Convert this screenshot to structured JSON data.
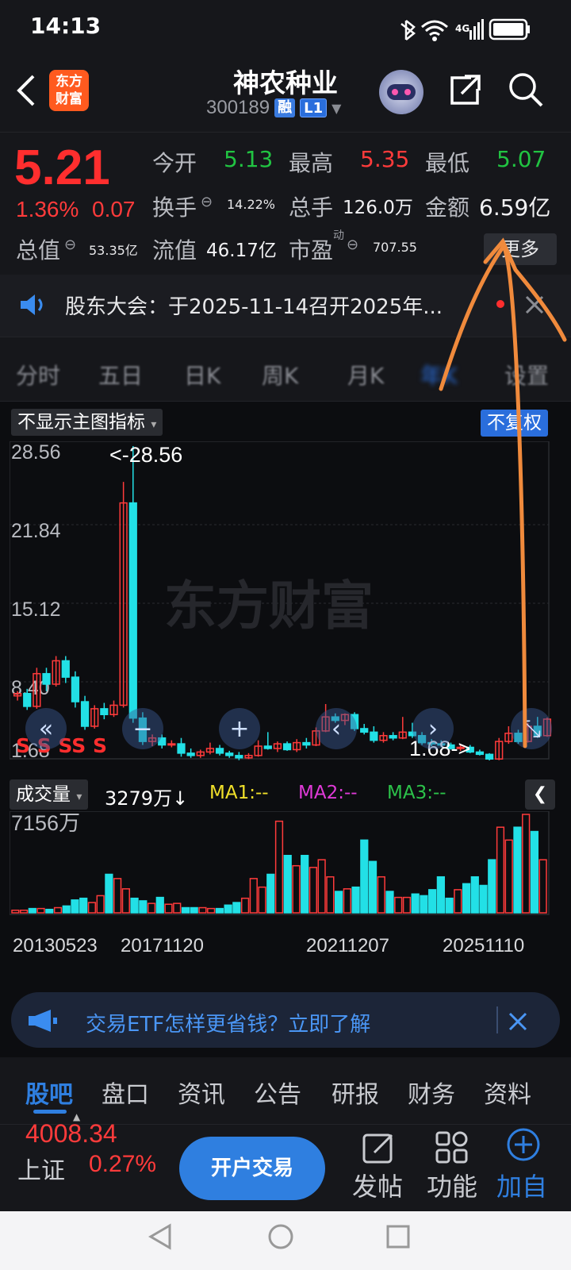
{
  "status_bar": {
    "time": "14:13",
    "network": "4G"
  },
  "header": {
    "back_icon": "chevron-left-icon",
    "logo_text": "东方\n财富",
    "title": "神农种业",
    "code": "300189",
    "tag_margin": "融",
    "tag_level": "L1"
  },
  "quote": {
    "price": "5.21",
    "change_pct": "1.36%",
    "change": "0.07",
    "open_label": "今开",
    "open": "5.13",
    "high_label": "最高",
    "high": "5.35",
    "low_label": "最低",
    "low": "5.07",
    "turnover_label": "换手",
    "turnover": "14.22%",
    "volume_label": "总手",
    "volume": "126.0万",
    "amount_label": "金额",
    "amount": "6.59亿",
    "mktcap_label": "总值",
    "mktcap": "53.35亿",
    "float_label": "流值",
    "float": "46.17亿",
    "pe_label": "市盈",
    "pe_sup": "动",
    "pe": "707.55",
    "more_label": "更多"
  },
  "notice": {
    "text": "股东大会：于2025-11-14召开2025年..."
  },
  "period_tabs": [
    "分时",
    "五日",
    "日K",
    "周K",
    "月K",
    "年K",
    "设置"
  ],
  "chart": {
    "indicator_label": "不显示主图指标",
    "adjust_label": "不复权",
    "y_ticks": [
      "28.56",
      "21.84",
      "15.12",
      "8.40",
      "1.68"
    ],
    "max_marker": "<-28.56",
    "min_marker": "1.68->",
    "watermark": "东方财富",
    "signals": "S   S   SS   S",
    "colors": {
      "up": "#ff3b3b",
      "down": "#22e0e6"
    }
  },
  "volume": {
    "label": "成交量",
    "current": "3279万↓",
    "ma1": "MA1:--",
    "ma2": "MA2:--",
    "ma3": "MA3:--",
    "max_label": "7156万"
  },
  "x_dates": [
    "20130523",
    "20171120",
    "20211207",
    "20251110"
  ],
  "ad": {
    "text": "交易ETF怎样更省钱？立即了解"
  },
  "bottom_tabs": [
    "股吧",
    "盘口",
    "资讯",
    "公告",
    "研报",
    "财务",
    "资料"
  ],
  "toolbar": {
    "index_value": "4008.34",
    "index_name": "上证",
    "index_change": "0.27%",
    "open_account": "开户交易",
    "post": "发帖",
    "functions": "功能",
    "add": "加自"
  },
  "chart_data": {
    "type": "candlestick",
    "ylim": [
      1.68,
      28.56
    ],
    "candles": [
      [
        7.2,
        7.6,
        6.8,
        7.4
      ],
      [
        7.4,
        7.8,
        6.0,
        6.3
      ],
      [
        6.3,
        9.6,
        6.1,
        9.1
      ],
      [
        9.1,
        9.6,
        7.6,
        8.2
      ],
      [
        8.2,
        10.6,
        8.0,
        10.2
      ],
      [
        10.2,
        10.6,
        8.3,
        8.8
      ],
      [
        8.8,
        9.3,
        6.2,
        6.7
      ],
      [
        6.7,
        7.2,
        4.3,
        4.6
      ],
      [
        4.6,
        6.4,
        4.4,
        6.1
      ],
      [
        6.1,
        6.6,
        5.2,
        5.6
      ],
      [
        5.6,
        6.8,
        5.4,
        6.4
      ],
      [
        6.4,
        25.5,
        6.2,
        23.7
      ],
      [
        23.7,
        28.56,
        4.9,
        5.3
      ],
      [
        5.3,
        5.8,
        3.0,
        3.3
      ],
      [
        3.3,
        3.9,
        2.9,
        3.6
      ],
      [
        3.6,
        3.9,
        2.7,
        3.0
      ],
      [
        3.0,
        3.4,
        2.8,
        3.1
      ],
      [
        3.1,
        3.6,
        2.0,
        2.3
      ],
      [
        2.3,
        2.7,
        1.9,
        2.1
      ],
      [
        2.1,
        2.6,
        1.9,
        2.4
      ],
      [
        2.4,
        3.2,
        2.2,
        2.7
      ],
      [
        2.7,
        3.0,
        2.1,
        2.3
      ],
      [
        2.3,
        2.5,
        1.9,
        2.1
      ],
      [
        2.1,
        2.4,
        1.7,
        1.9
      ],
      [
        1.9,
        2.3,
        1.8,
        2.1
      ],
      [
        2.1,
        3.4,
        2.0,
        2.9
      ],
      [
        2.9,
        4.1,
        2.6,
        2.7
      ],
      [
        2.7,
        3.3,
        2.4,
        3.1
      ],
      [
        3.1,
        3.3,
        2.5,
        2.6
      ],
      [
        2.6,
        3.5,
        2.4,
        3.2
      ],
      [
        3.2,
        3.6,
        2.7,
        3.0
      ],
      [
        3.0,
        4.5,
        2.9,
        4.2
      ],
      [
        4.2,
        6.5,
        4.1,
        5.4
      ],
      [
        5.4,
        5.7,
        4.9,
        5.1
      ],
      [
        5.1,
        5.7,
        4.7,
        5.6
      ],
      [
        5.6,
        5.8,
        4.2,
        4.4
      ],
      [
        4.4,
        4.8,
        3.9,
        4.1
      ],
      [
        4.1,
        4.6,
        3.2,
        3.4
      ],
      [
        3.4,
        4.1,
        3.2,
        3.8
      ],
      [
        3.8,
        4.1,
        3.4,
        3.6
      ],
      [
        3.6,
        5.4,
        3.5,
        4.1
      ],
      [
        4.1,
        4.9,
        3.6,
        3.8
      ],
      [
        3.8,
        4.1,
        3.0,
        3.2
      ],
      [
        3.2,
        3.5,
        2.9,
        3.1
      ],
      [
        3.1,
        3.4,
        2.8,
        3.0
      ],
      [
        3.0,
        3.2,
        2.6,
        2.7
      ],
      [
        2.7,
        3.0,
        2.5,
        2.8
      ],
      [
        2.8,
        3.0,
        2.3,
        2.4
      ],
      [
        2.4,
        2.6,
        2.1,
        2.2
      ],
      [
        2.2,
        2.3,
        1.68,
        1.8
      ],
      [
        1.8,
        3.6,
        1.7,
        3.3
      ],
      [
        3.3,
        4.6,
        3.1,
        4.0
      ],
      [
        4.0,
        4.3,
        3.1,
        3.3
      ],
      [
        3.3,
        4.9,
        3.2,
        4.6
      ],
      [
        4.6,
        5.4,
        3.6,
        3.8
      ],
      [
        3.8,
        5.35,
        3.7,
        5.21
      ]
    ],
    "volume": [
      3,
      3,
      5,
      5,
      4,
      6,
      8,
      15,
      17,
      12,
      20,
      45,
      40,
      28,
      17,
      14,
      11,
      18,
      10,
      11,
      6,
      6,
      6,
      5,
      5,
      9,
      12,
      17,
      40,
      30,
      45,
      107,
      67,
      55,
      67,
      53,
      62,
      42,
      25,
      28,
      30,
      85,
      60,
      42,
      25,
      18,
      18,
      22,
      20,
      27,
      42,
      17,
      27,
      34,
      42,
      32,
      62,
      100,
      85,
      100,
      115,
      95,
      62
    ]
  }
}
